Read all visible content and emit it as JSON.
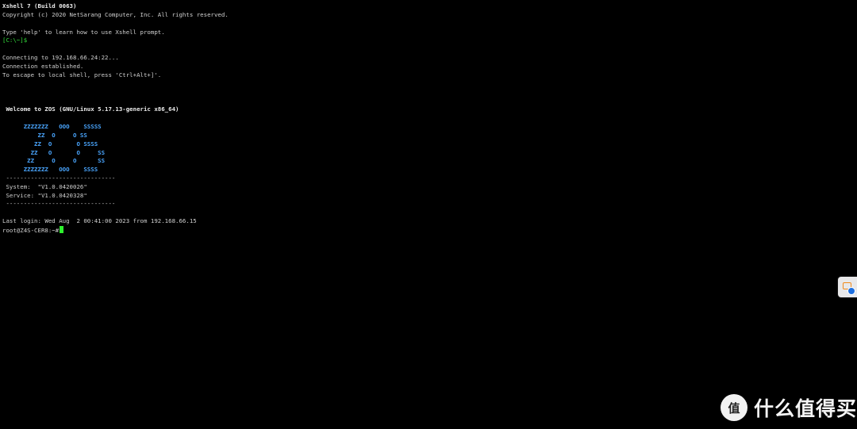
{
  "terminal": {
    "header_title": "Xshell 7 (Build 0063)",
    "copyright": "Copyright (c) 2020 NetSarang Computer, Inc. All rights reserved.",
    "help_hint": "Type 'help' to learn how to use Xshell prompt.",
    "local_prompt": "[C:\\~]$",
    "connecting": "Connecting to 192.168.66.24:22...",
    "established": "Connection established.",
    "escape_hint": "To escape to local shell, press 'Ctrl+Alt+]'.",
    "welcome": " Welcome to ZOS (GNU/Linux 5.17.13-generic x86_64)",
    "ascii_art": [
      "      ZZZZZZZ   OOO    SSSSS",
      "          ZZ  O     O SS",
      "         ZZ  O       O SSSS",
      "        ZZ   O       O     SS",
      "       ZZ     O     O      SS",
      "      ZZZZZZZ   OOO    SSSS"
    ],
    "separator": " -------------------------------",
    "system_line": " System:  \"V1.0.0420026\"",
    "service_line": " Service: \"V1.0.0420328\"",
    "last_login": "Last login: Wed Aug  2 00:41:00 2023 from 192.168.66.15",
    "remote_prompt": "root@Z4S-CER8:~#"
  },
  "watermark": {
    "logo_glyph": "值",
    "text": "什么值得买"
  },
  "colors": {
    "background": "#000000",
    "prompt_green": "#34e03c",
    "ascii_blue": "#4aa6ff",
    "cursor_green": "#2df02d"
  },
  "icons": {
    "side_widget": "notification-widget-icon",
    "watermark_logo": "smzdm-logo-icon"
  }
}
